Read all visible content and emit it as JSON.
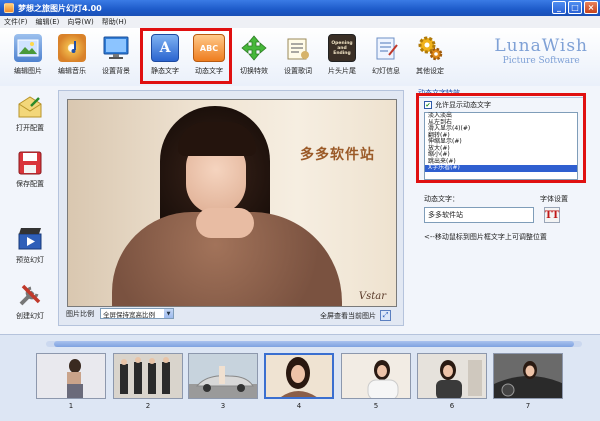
{
  "window": {
    "title": "梦想之旅图片幻灯4.00",
    "min": "_",
    "max": "□",
    "close": "×"
  },
  "menu": [
    "文件(F)",
    "编辑(E)",
    "向导(W)",
    "帮助(H)"
  ],
  "toolbar": [
    {
      "label": "编辑图片",
      "icon": "image-edit-icon",
      "color": "#5b8fd8"
    },
    {
      "label": "编辑音乐",
      "icon": "music-disc-icon",
      "color": "#e09a2c"
    },
    {
      "label": "设置背景",
      "icon": "monitor-icon",
      "color": "#2f7cd6"
    },
    {
      "label": "静态文字",
      "icon": "static-text-icon",
      "color": "#2b74d8",
      "glyph": "A"
    },
    {
      "label": "动态文字",
      "icon": "dynamic-text-icon",
      "color": "#f28a2a",
      "glyph": "ABC"
    },
    {
      "label": "切换特效",
      "icon": "transition-arrows-icon",
      "color": "#46b83a"
    },
    {
      "label": "设置歌词",
      "icon": "lyrics-icon",
      "color": "#d6b36a"
    },
    {
      "label": "片头片尾",
      "icon": "film-strip-icon",
      "color": "#5a4a3a",
      "glyph": "Opening and Ending"
    },
    {
      "label": "幻灯信息",
      "icon": "info-notepad-icon",
      "color": "#6d8fc6"
    },
    {
      "label": "其他设定",
      "icon": "gears-icon",
      "color": "#e0a21a"
    }
  ],
  "brand": {
    "line1": "LunaWish",
    "line2": "Picture Software"
  },
  "left_panel": [
    {
      "label": "打开配置",
      "icon": "open-envelope-icon",
      "color": "#e8c14a"
    },
    {
      "label": "保存配置",
      "icon": "save-disk-icon",
      "color": "#d9343a"
    },
    {
      "label": "预览幻灯",
      "icon": "play-clapper-icon",
      "color": "#2f5fb8"
    },
    {
      "label": "创建幻灯",
      "icon": "tools-icon",
      "color": "#c0392b"
    }
  ],
  "preview": {
    "overlay_text": "多多软件站",
    "watermark": "Vstar"
  },
  "ratio": {
    "label": "图片比例",
    "value": "全屏保持宽高比例"
  },
  "fullview": {
    "label": "全屏查看当前图片"
  },
  "effects": {
    "title": "动态文字特效",
    "checkbox_label": "允许显示动态文字",
    "checked": true,
    "items": [
      "淡入淡出",
      "从左到右",
      "滑入显示(4)(#)",
      "翻转(#)",
      "伸缩显示(#)",
      "放大(#)",
      "缩小(#)",
      "跳出来(#)",
      "X字乐看(#)"
    ],
    "selected_index": 8
  },
  "dynamic_text": {
    "label": "动态文字：",
    "value": "多多软件站",
    "font_label": "字体设置",
    "font_glyph": "TT"
  },
  "hint": "<--移动鼠标到图片框文字上可调整位置",
  "thumbnails": [
    {
      "num": "1",
      "active": false
    },
    {
      "num": "2",
      "active": false
    },
    {
      "num": "3",
      "active": false
    },
    {
      "num": "4",
      "active": true
    },
    {
      "num": "5",
      "active": false
    },
    {
      "num": "6",
      "active": false
    },
    {
      "num": "7",
      "active": false
    }
  ]
}
